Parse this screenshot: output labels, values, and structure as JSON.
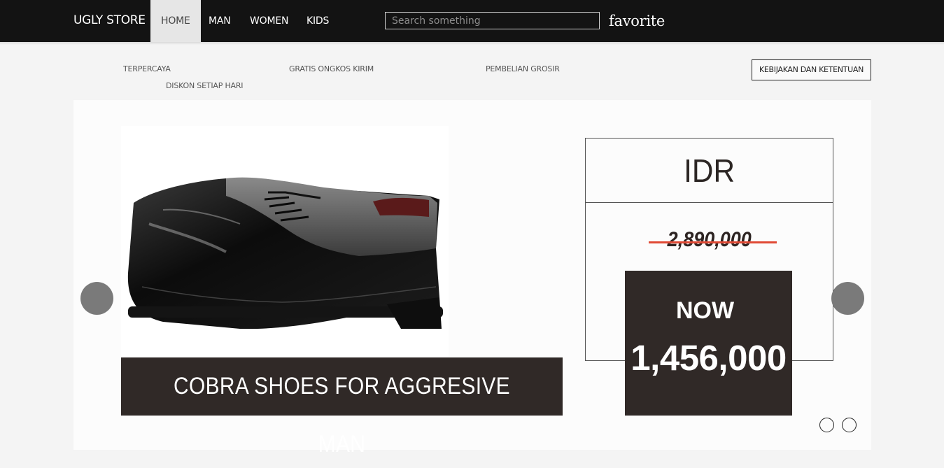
{
  "navbar": {
    "brand": "UGLY STORE",
    "items": [
      {
        "label": "HOME",
        "active": true
      },
      {
        "label": "MAN",
        "active": false
      },
      {
        "label": "WOMEN",
        "active": false
      },
      {
        "label": "KIDS",
        "active": false
      }
    ],
    "search_placeholder": "Search something",
    "favorite": "favorite"
  },
  "features": {
    "items": [
      "TERPERCAYA",
      "GRATIS ONGKOS KIRIM",
      "PEMBELIAN GROSIR",
      "DISKON SETIAP HARI"
    ],
    "policy_button": "KEBIJAKAN DAN KETENTUAN"
  },
  "slider": {
    "caption": "COBRA SHOES FOR AGGRESIVE MAN",
    "currency": "IDR",
    "old_price": "2,890,000",
    "now_label": "NOW",
    "now_price": "1,456,000",
    "slide_count": 2
  },
  "colors": {
    "navbar_bg": "#131313",
    "dark_panel": "#302927",
    "strike": "#e04a35",
    "arrow": "#7a7a7a"
  }
}
